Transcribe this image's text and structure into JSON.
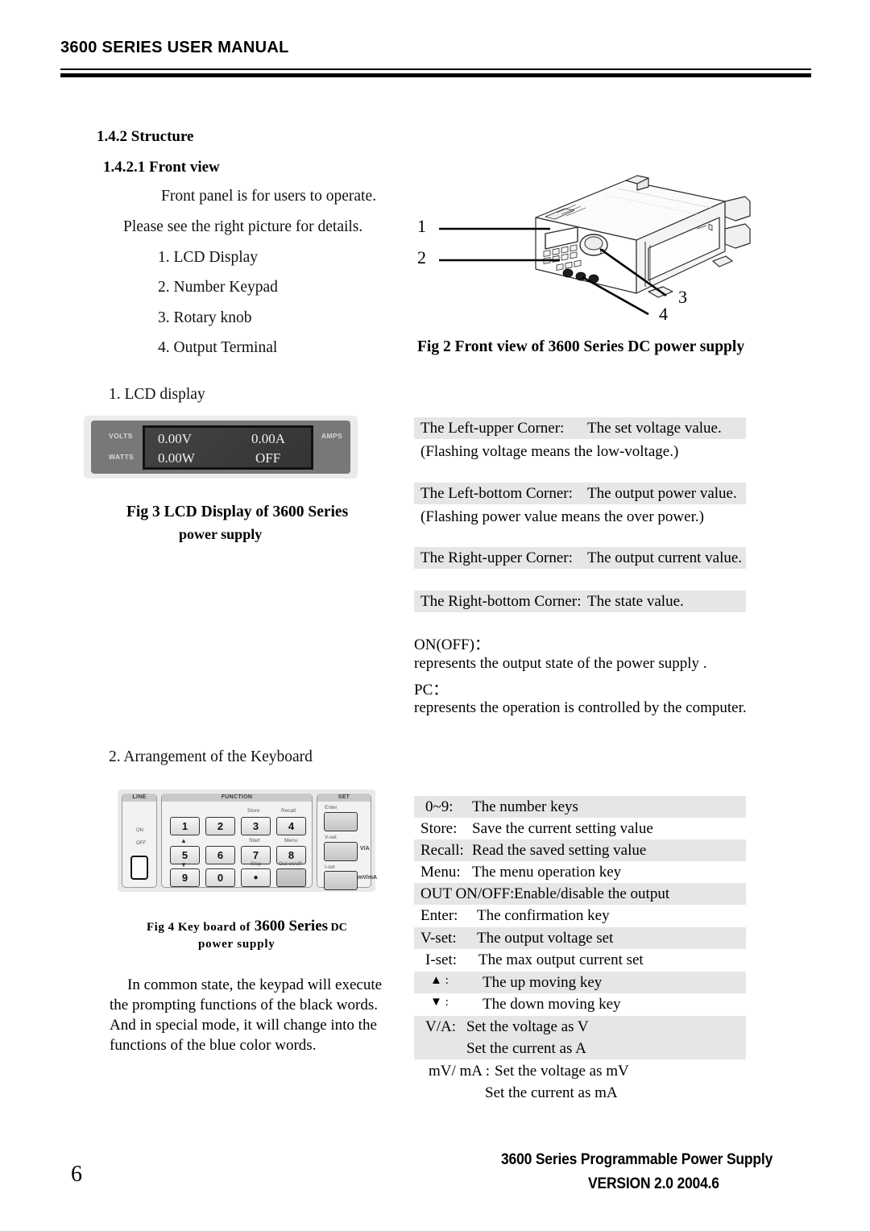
{
  "header": {
    "title": "3600 SERIES USER MANUAL"
  },
  "sections": {
    "structure": "1.4.2 Structure",
    "front_view": "1.4.2.1 Front view"
  },
  "intro": {
    "line1": "Front panel is for users to operate.",
    "line2": "Please see the right picture for details.",
    "items": [
      "1. LCD  Display",
      "2. Number  Keypad",
      "3. Rotary  knob",
      "4. Output  Terminal"
    ]
  },
  "subheads": {
    "lcd_display": "1. LCD display",
    "keyboard": "2. Arrangement of the Keyboard"
  },
  "fig2": {
    "caption": "Fig 2 Front view of 3600 Series DC power supply",
    "callouts": [
      "1",
      "2",
      "3",
      "4"
    ]
  },
  "fig3": {
    "caption_line1": "Fig 3 LCD Display of 3600 Series",
    "caption_line2": "power supply",
    "lcd": {
      "volts_label": "VOLTS",
      "watts_label": "WATTS",
      "amps_label": "AMPS",
      "voltage_value": "0.00V",
      "current_value": "0.00A",
      "power_value": "0.00W",
      "state_value": "OFF"
    }
  },
  "corner_table": {
    "rows": [
      {
        "label": "The Left-upper Corner:",
        "value": "The set voltage value.",
        "shaded": true
      },
      {
        "label": "(Flashing voltage means the low-voltage.)",
        "value": "",
        "shaded": false
      },
      {
        "label": "The Left-bottom Corner:",
        "value": "The output power value.",
        "shaded": true
      },
      {
        "label": "(Flashing power value means the over power.)",
        "value": "",
        "shaded": false
      },
      {
        "label": "The Right-upper Corner:",
        "value": "The output current value.",
        "shaded": true
      },
      {
        "label": "The Right-bottom Corner:",
        "value": "The state value.",
        "shaded": true
      }
    ]
  },
  "state_notes": {
    "onoff_label": "ON(OFF)：",
    "onoff_desc": "represents the output state of the power supply .",
    "pc_label": "PC：",
    "pc_desc": "represents the operation is controlled by the computer."
  },
  "fig4": {
    "caption_small_1": "Fig 4 Key board of",
    "caption_big": "3600 Series",
    "caption_caps": "DC",
    "caption_line2": "power supply",
    "keypad": {
      "group_line": "LINE",
      "group_function": "FUNCTION",
      "group_set": "SET",
      "number_keys": [
        "1",
        "2",
        "3",
        "4",
        "5",
        "6",
        "7",
        "8",
        "9",
        "0",
        "●"
      ],
      "blue_labels": [
        "Store",
        "Recall",
        "Start",
        "Menu",
        "Stop",
        "Out on/off"
      ],
      "set_labels": [
        "Enter",
        "V-set",
        "I-set"
      ],
      "set_side_labels": [
        "V/A",
        "mV/mA"
      ],
      "up_arrow": "▲",
      "down_arrow": "▼",
      "line_marks": [
        "ON",
        "OFF"
      ]
    }
  },
  "closing_paragraph": {
    "line1": "In common state, the keypad  will execute",
    "line2": "the prompting functions of the black words.",
    "line3": "And in special mode, it will change into the",
    "line4": "functions of the blue color words."
  },
  "key_table": {
    "rows": [
      {
        "key": "0~9:",
        "desc": "The number keys",
        "shaded": true
      },
      {
        "key": "Store:",
        "desc": "Save the current setting value",
        "shaded": false
      },
      {
        "key": "Recall:",
        "desc": "Read the saved setting value",
        "shaded": true
      },
      {
        "key": "Menu:",
        "desc": "The menu operation key",
        "shaded": false
      },
      {
        "key": "OUT ON/OFF:",
        "desc": "Enable/disable the output",
        "shaded": true
      },
      {
        "key": "Enter:",
        "desc": "The confirmation key",
        "shaded": false
      },
      {
        "key": "V-set:",
        "desc": "The output voltage set",
        "shaded": true
      },
      {
        "key": "I-set:",
        "desc": "The max output current set",
        "shaded": false
      },
      {
        "key": "▲ :",
        "desc": "The up moving key",
        "shaded": true
      },
      {
        "key": "▼ :",
        "desc": "The down moving key",
        "shaded": false
      },
      {
        "key": "V/A:",
        "desc": "Set the voltage as V",
        "shaded": true
      },
      {
        "key": "",
        "desc": "Set the current as  A",
        "shaded": true
      },
      {
        "key": "mV/ mA :",
        "desc": "Set the voltage as mV",
        "shaded": false
      },
      {
        "key": "",
        "desc": "Set the current as mA",
        "shaded": false
      }
    ]
  },
  "footer": {
    "page_number": "6",
    "line1": "3600 Series Programmable Power Supply",
    "line2": "VERSION 2.0  2004.6"
  },
  "colors": {
    "shade": "#e6e6e6",
    "lcd_screen": "#3a3a3a",
    "lcd_bezel": "#787878"
  }
}
